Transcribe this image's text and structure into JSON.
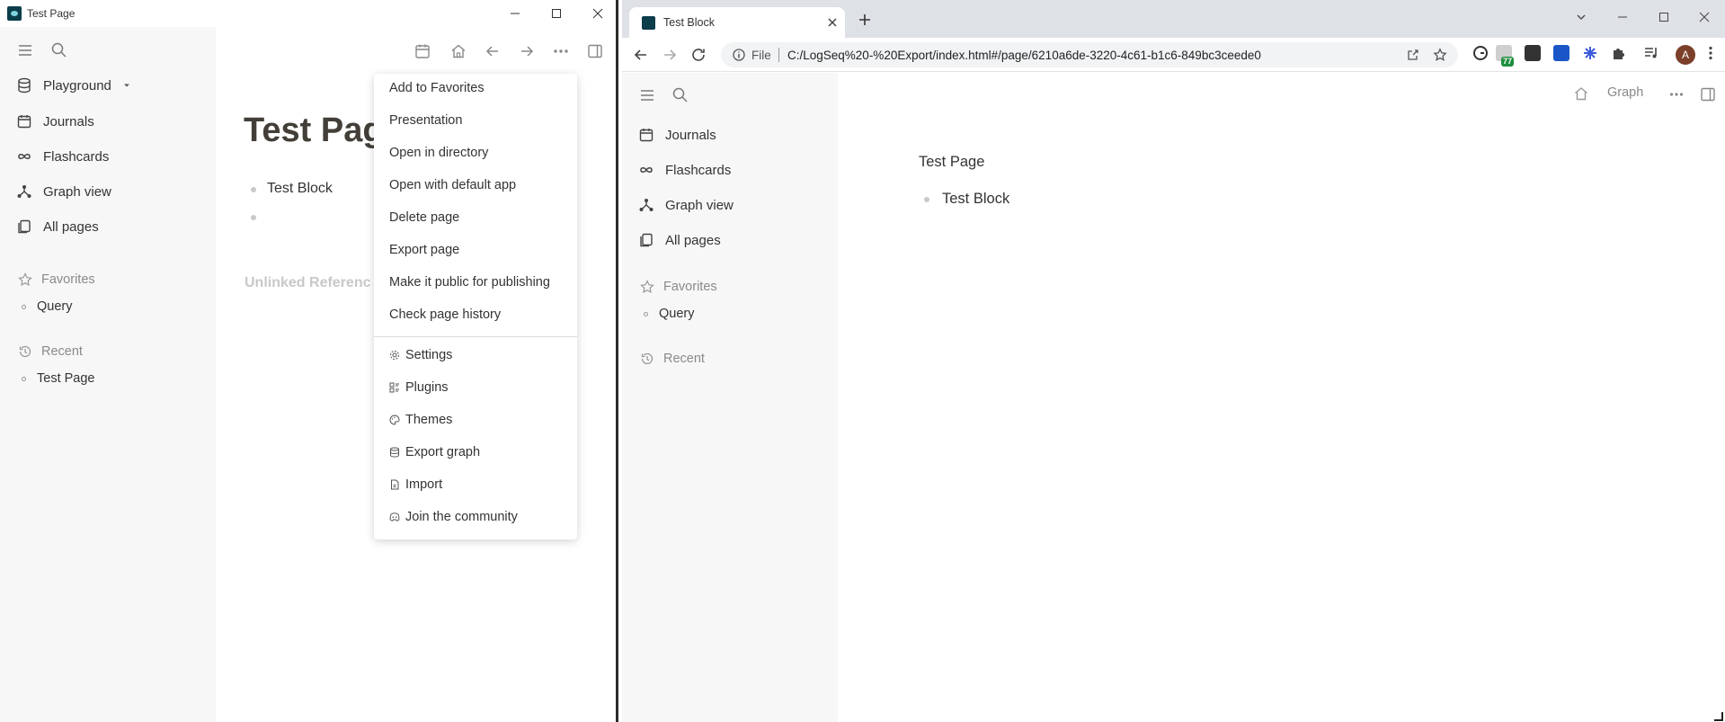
{
  "left_window": {
    "title": "Test Page",
    "sidebar": {
      "graph_name": "Playground",
      "nav": [
        {
          "label": "Journals",
          "icon": "calendar-icon"
        },
        {
          "label": "Flashcards",
          "icon": "infinity-icon"
        },
        {
          "label": "Graph view",
          "icon": "graph-icon"
        },
        {
          "label": "All pages",
          "icon": "pages-icon"
        }
      ],
      "favorites_label": "Favorites",
      "favorites": [
        "Query"
      ],
      "recent_label": "Recent",
      "recent": [
        "Test Page"
      ]
    },
    "page": {
      "title": "Test Pag",
      "block": "Test Block",
      "unlinked": "Unlinked Referenc"
    },
    "menu": {
      "items": [
        "Add to Favorites",
        "Presentation",
        "Open in directory",
        "Open with default app",
        "Delete page",
        "Export page",
        "Make it public for publishing",
        "Check page history"
      ],
      "icon_items": [
        {
          "label": "Settings",
          "icon": "gear-icon"
        },
        {
          "label": "Plugins",
          "icon": "plugins-icon"
        },
        {
          "label": "Themes",
          "icon": "palette-icon"
        },
        {
          "label": "Export graph",
          "icon": "database-icon"
        },
        {
          "label": "Import",
          "icon": "file-icon"
        },
        {
          "label": "Join the community",
          "icon": "discord-icon"
        }
      ]
    }
  },
  "right_window": {
    "tab_title": "Test Block",
    "omnibox": {
      "scheme_label": "File",
      "url": "C:/LogSeq%20-%20Export/index.html#/page/6210a6de-3220-4c61-b1c6-849bc3ceede0"
    },
    "extension_badge": "77",
    "avatar_letter": "A",
    "sidebar": {
      "nav": [
        {
          "label": "Journals",
          "icon": "calendar-icon"
        },
        {
          "label": "Flashcards",
          "icon": "infinity-icon"
        },
        {
          "label": "Graph view",
          "icon": "graph-icon"
        },
        {
          "label": "All pages",
          "icon": "pages-icon"
        }
      ],
      "favorites_label": "Favorites",
      "favorites": [
        "Query"
      ],
      "recent_label": "Recent"
    },
    "header_graph_label": "Graph",
    "page": {
      "title": "Test Page",
      "block": "Test Block"
    }
  }
}
